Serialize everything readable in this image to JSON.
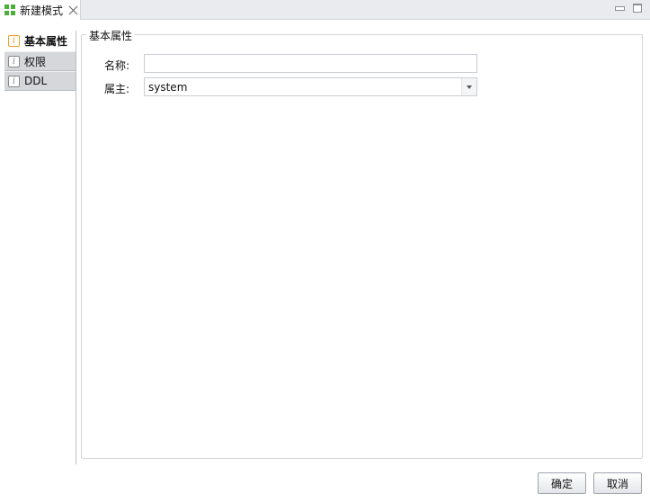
{
  "tab": {
    "title": "新建模式",
    "icon": "grid-icon"
  },
  "nav": {
    "items": [
      {
        "label": "基本属性",
        "active": true
      },
      {
        "label": "权限",
        "active": false
      },
      {
        "label": "DDL",
        "active": false
      }
    ]
  },
  "form": {
    "group_title": "基本属性",
    "name_label": "名称:",
    "name_value": "",
    "owner_label": "属主:",
    "owner_value": "system"
  },
  "buttons": {
    "ok": "确定",
    "cancel": "取消"
  },
  "colors": {
    "accent_icon": "#4caf3a",
    "active_info_icon": "#f0a020"
  }
}
